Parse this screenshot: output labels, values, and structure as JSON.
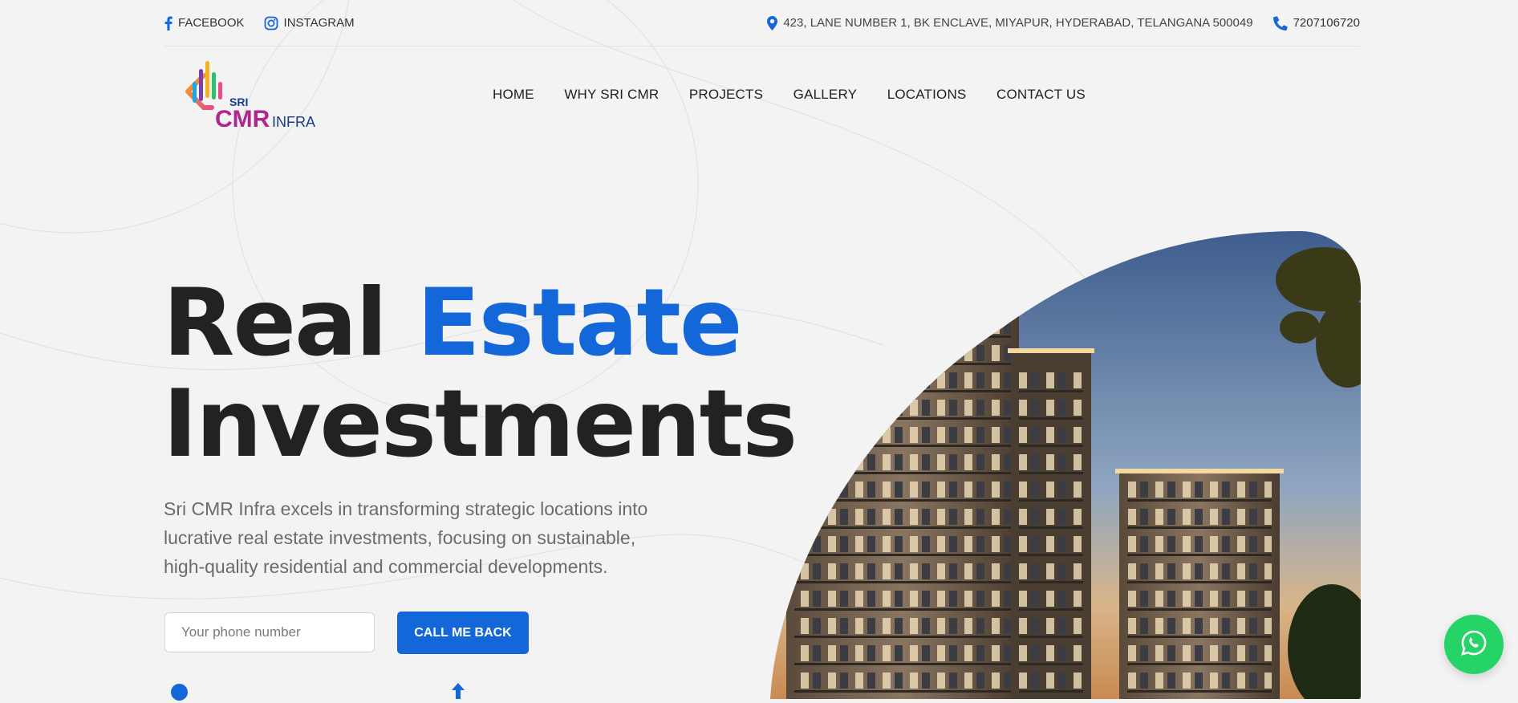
{
  "topbar": {
    "social": [
      {
        "label": "FACEBOOK",
        "icon": "facebook-icon"
      },
      {
        "label": "INSTAGRAM",
        "icon": "instagram-icon"
      }
    ],
    "address": "423, LANE NUMBER 1, BK ENCLAVE, MIYAPUR, HYDERABAD, TELANGANA 500049",
    "phone": "7207106720"
  },
  "logo": {
    "line1": "SRI",
    "line2": "CMR",
    "line3": "INFRA"
  },
  "nav": [
    {
      "label": "HOME"
    },
    {
      "label": "WHY SRI CMR"
    },
    {
      "label": "PROJECTS"
    },
    {
      "label": "GALLERY"
    },
    {
      "label": "LOCATIONS"
    },
    {
      "label": "CONTACT US"
    }
  ],
  "hero": {
    "title_part1": "Real ",
    "title_accent": "Estate",
    "title_part2": "Investments",
    "description": "Sri CMR Infra excels in transforming strategic locations into lucrative real estate investments, focusing on sustainable, high-quality residential and commercial developments.",
    "phone_placeholder": "Your phone number",
    "cta_label": "CALL ME BACK"
  },
  "colors": {
    "accent": "#1467d8",
    "background": "#f3f3f3",
    "text": "#222222",
    "whatsapp": "#25d366"
  },
  "floating": {
    "icon": "whatsapp-icon"
  }
}
